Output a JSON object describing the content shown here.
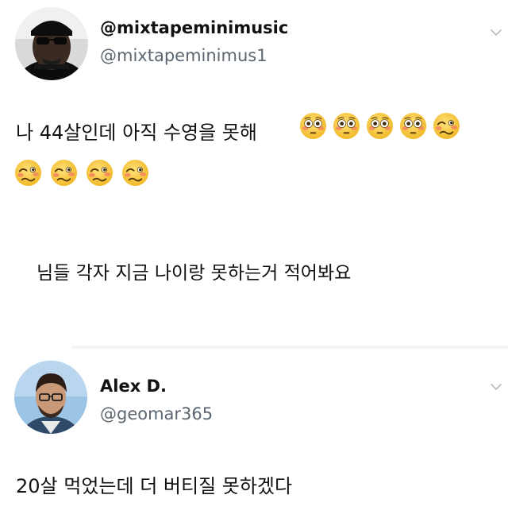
{
  "tweets": [
    {
      "display_name": "@mixtapeminimusic",
      "handle": "@mixtapeminimus1",
      "avatar_icon": "person-sunglasses-avatar",
      "text_line1": "나 44살인데 아직 수영을 못해",
      "emoji_row1": [
        "flushed-face",
        "flushed-face",
        "flushed-face",
        "flushed-face",
        "woozy-face"
      ],
      "emoji_row2": [
        "woozy-face",
        "woozy-face",
        "woozy-face",
        "woozy-face"
      ],
      "text_line2": "님들 각자 지금 나이랑 못하는거 적어봐요"
    },
    {
      "display_name": "Alex D.",
      "handle": "@geomar365",
      "avatar_icon": "person-glasses-avatar",
      "text": "20살 먹었는데 더 버티질 못하겠다"
    }
  ],
  "colors": {
    "text": "#111111",
    "handle": "#5b6670",
    "emoji_yellow": "#f6c636",
    "divider": "#eceff1"
  }
}
